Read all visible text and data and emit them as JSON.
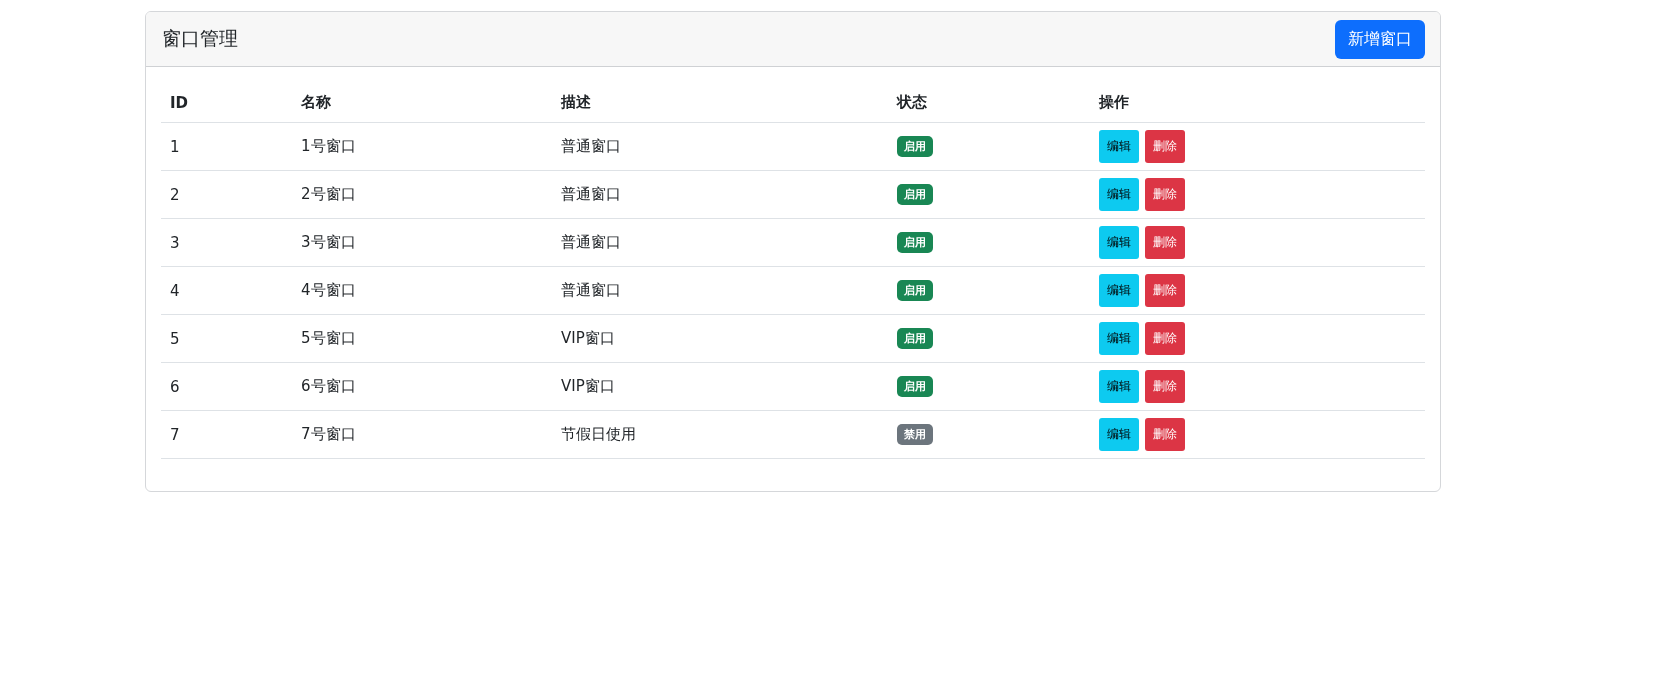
{
  "card": {
    "title": "窗口管理",
    "add_button": "新增窗口"
  },
  "table": {
    "columns": [
      "ID",
      "名称",
      "描述",
      "状态",
      "操作"
    ],
    "rows": [
      {
        "id": "1",
        "name": "1号窗口",
        "description": "普通窗口",
        "status": {
          "label": "启用",
          "enabled": true
        },
        "actions": [
          "编辑",
          "删除"
        ]
      },
      {
        "id": "2",
        "name": "2号窗口",
        "description": "普通窗口",
        "status": {
          "label": "启用",
          "enabled": true
        },
        "actions": [
          "编辑",
          "删除"
        ]
      },
      {
        "id": "3",
        "name": "3号窗口",
        "description": "普通窗口",
        "status": {
          "label": "启用",
          "enabled": true
        },
        "actions": [
          "编辑",
          "删除"
        ]
      },
      {
        "id": "4",
        "name": "4号窗口",
        "description": "普通窗口",
        "status": {
          "label": "启用",
          "enabled": true
        },
        "actions": [
          "编辑",
          "删除"
        ]
      },
      {
        "id": "5",
        "name": "5号窗口",
        "description": "VIP窗口",
        "status": {
          "label": "启用",
          "enabled": true
        },
        "actions": [
          "编辑",
          "删除"
        ]
      },
      {
        "id": "6",
        "name": "6号窗口",
        "description": "VIP窗口",
        "status": {
          "label": "启用",
          "enabled": true
        },
        "actions": [
          "编辑",
          "删除"
        ]
      },
      {
        "id": "7",
        "name": "7号窗口",
        "description": "节假日使用",
        "status": {
          "label": "禁用",
          "enabled": false
        },
        "actions": [
          "编辑",
          "删除"
        ]
      }
    ]
  }
}
